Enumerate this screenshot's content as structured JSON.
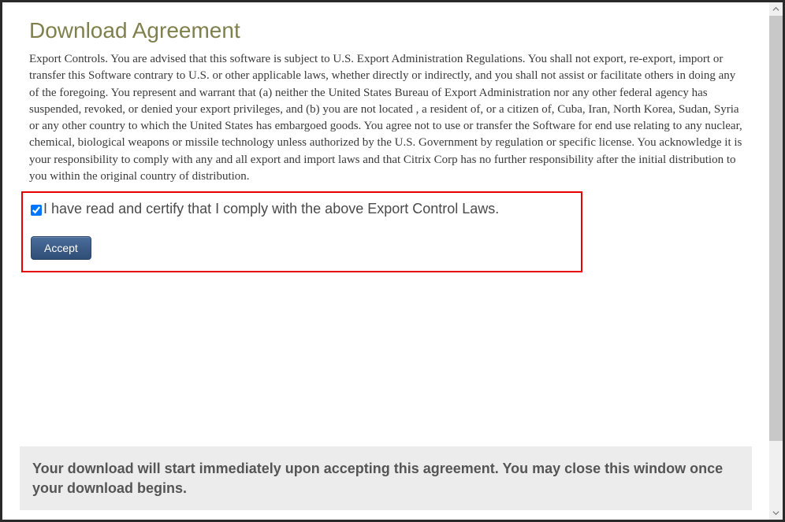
{
  "title": "Download Agreement",
  "agreement_text": "Export Controls. You are advised that this software is subject to U.S. Export Administration Regulations. You shall not export, re-export, import or transfer this Software contrary to U.S. or other applicable laws, whether directly or indirectly, and you shall not assist or facilitate others in doing any of the foregoing. You represent and warrant that (a) neither the United States Bureau of Export Administration nor any other federal agency has suspended, revoked, or denied your export privileges, and (b) you are not located , a resident of, or a citizen of, Cuba, Iran, North Korea, Sudan, Syria or any other country to which the United States has embargoed goods. You agree not to use or transfer the Software for end use relating to any nuclear, chemical, biological weapons or missile technology unless authorized by the U.S. Government by regulation or specific license. You acknowledge it is your responsibility to comply with any and all export and import laws and that Citrix Corp has no further responsibility after the initial distribution to you within the original country of distribution.",
  "certify_label": "I have read and certify that I comply with the above Export Control Laws.",
  "certify_checked": true,
  "accept_label": "Accept",
  "footer_note": "Your download will start immediately upon accepting this agreement. You may close this window once your download begins."
}
